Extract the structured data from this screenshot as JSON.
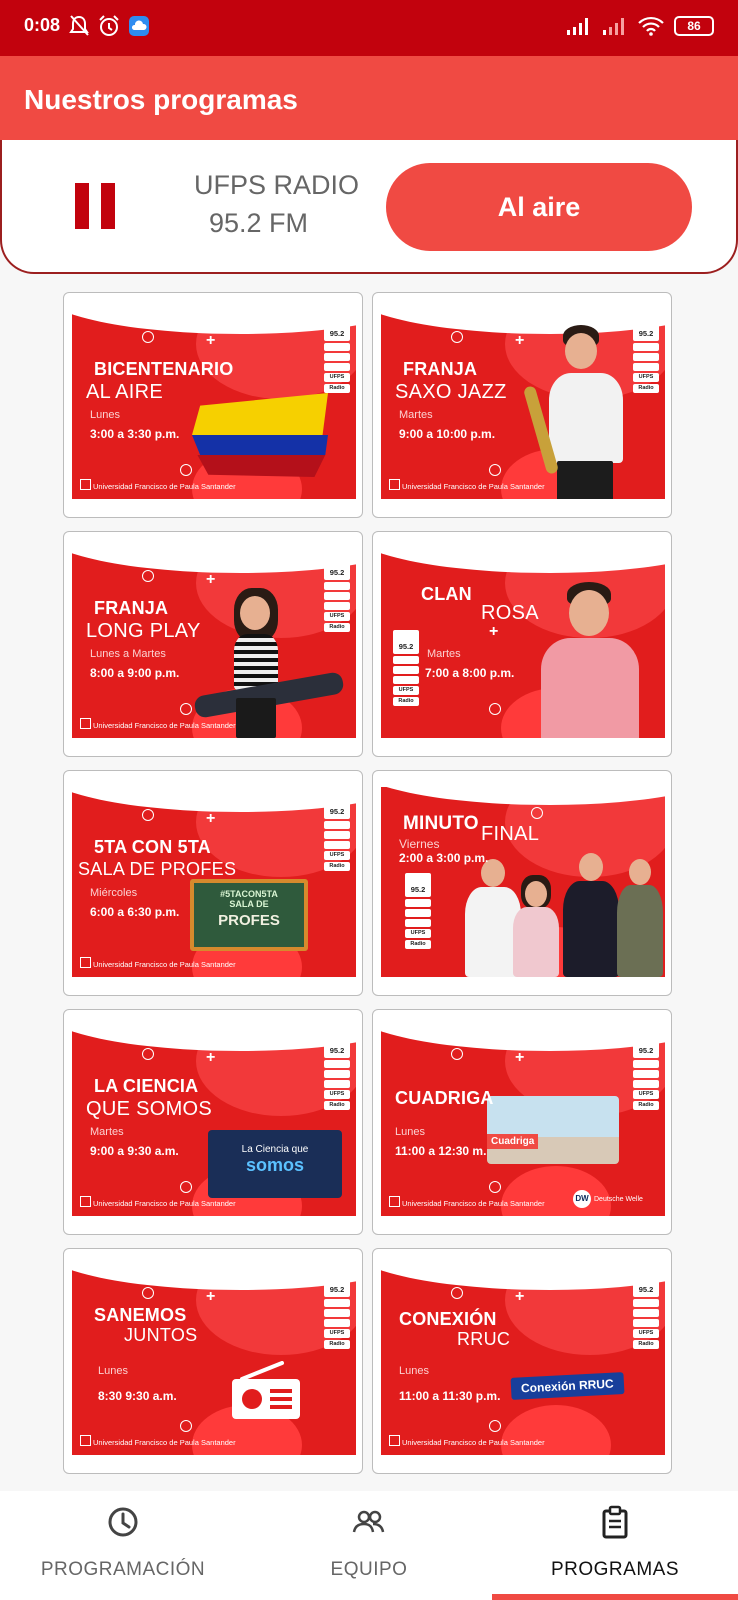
{
  "status_bar": {
    "time": "0:08",
    "battery": "86",
    "icons": [
      "bell-off-icon",
      "alarm-icon",
      "cloud-app-icon",
      "signal-icon",
      "signal-icon",
      "wifi-icon",
      "battery-icon"
    ]
  },
  "app_bar": {
    "title": "Nuestros programas"
  },
  "player": {
    "station_name": "UFPS RADIO",
    "frequency": "95.2 FM",
    "live_label": "Al aire",
    "state_icon": "pause-icon"
  },
  "poster_common": {
    "university": "Universidad Francisco de Paula Santander",
    "logo_freq": "95.2",
    "logo_ufps": "UFPS",
    "logo_radio": "Radio"
  },
  "programs": [
    {
      "title1": "BICENTENARIO",
      "title2": "AL AIRE",
      "day": "Lunes",
      "time": "3:00 a 3:30 p.m."
    },
    {
      "title1": "FRANJA",
      "title2": "SAXO JAZZ",
      "day": "Martes",
      "time": "9:00 a 10:00 p.m."
    },
    {
      "title1": "FRANJA",
      "title2": "LONG PLAY",
      "day": "Lunes a Martes",
      "time": "8:00 a 9:00 p.m."
    },
    {
      "title1": "CLAN",
      "title2": "ROSA",
      "day": "Martes",
      "time": "7:00 a 8:00 p.m."
    },
    {
      "title1": "5TA CON 5TA",
      "title2": "SALA DE PROFES",
      "day": "Miércoles",
      "time": "6:00 a 6:30 p.m.",
      "badge_top": "#5TACON5TA",
      "badge_mid": "SALA DE",
      "badge_main": "PROFES"
    },
    {
      "title1": "MINUTO",
      "title2": "FINAL",
      "day": "Viernes",
      "time": "2:00 a 3:00 p.m."
    },
    {
      "title1": "LA CIENCIA",
      "title2": "QUE SOMOS",
      "day": "Martes",
      "time": "9:00 a 9:30 a.m.",
      "badge_top": "La Ciencia que",
      "badge_main": "somos"
    },
    {
      "title1": "CUADRIGA",
      "title2": "",
      "day": "Lunes",
      "time": "11:00 a 12:30 m.",
      "badge_main": "Cuadriga",
      "partner": "Deutsche Welle",
      "partner_logo": "DW"
    },
    {
      "title1": "SANEMOS",
      "title2": "JUNTOS",
      "day": "Lunes",
      "time": "8:30 9:30 a.m."
    },
    {
      "title1": "CONEXIÓN",
      "title2": "RRUC",
      "day": "Lunes",
      "time": "11:00 a 11:30 p.m.",
      "badge_main": "Conexión RRUC"
    }
  ],
  "bottom_nav": {
    "items": [
      {
        "label": "PROGRAMACIÓN",
        "icon": "clock-icon"
      },
      {
        "label": "EQUIPO",
        "icon": "people-icon"
      },
      {
        "label": "PROGRAMAS",
        "icon": "clipboard-icon"
      }
    ],
    "selected": "PROGRAMAS"
  },
  "colors": {
    "status_bar": "#c2020d",
    "app_bar": "#f04a43",
    "accent": "#f04a43",
    "poster_red": "#e11d1d"
  }
}
